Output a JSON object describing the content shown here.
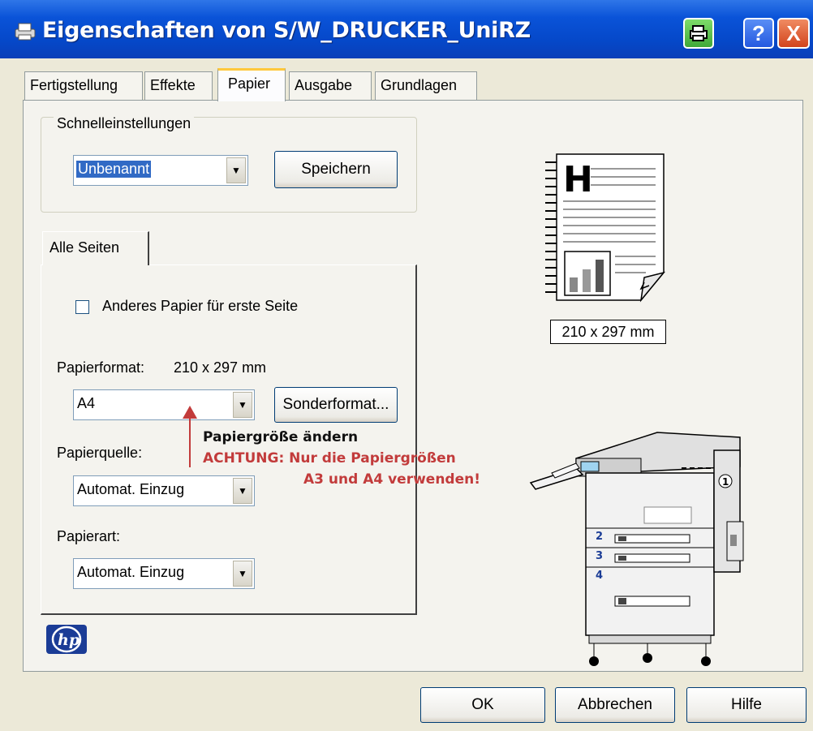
{
  "window": {
    "title": "Eigenschaften von S/W_DRUCKER_UniRZ"
  },
  "titlebar_buttons": {
    "help": "?",
    "close": "X"
  },
  "tabs": [
    "Fertigstellung",
    "Effekte",
    "Papier",
    "Ausgabe",
    "Grundlagen"
  ],
  "active_tab": "Papier",
  "quick_settings": {
    "legend": "Schnelleinstellungen",
    "selected": "Unbenannt",
    "save_label": "Speichern"
  },
  "inner_tab": "Alle Seiten",
  "first_page": {
    "label": "Anderes Papier für erste Seite",
    "checked": false
  },
  "paper_format": {
    "label": "Papierformat:",
    "value_text": "210 x 297 mm",
    "selected": "A4",
    "custom_label": "Sonderformat..."
  },
  "paper_source": {
    "label": "Papierquelle:",
    "selected": "Automat. Einzug"
  },
  "paper_type": {
    "label": "Papierart:",
    "selected": "Automat. Einzug"
  },
  "annotation": {
    "title": "Papiergröße ändern",
    "warning_line1": "ACHTUNG:  Nur die Papiergrößen",
    "warning_line2": "A3 und A4 verwenden!",
    "color": "#c23b3b"
  },
  "preview": {
    "size_text": "210 x 297 mm",
    "page_letter": "H"
  },
  "printer_trays": [
    "1",
    "2",
    "3",
    "4"
  ],
  "footer": {
    "ok": "OK",
    "cancel": "Abbrechen",
    "help": "Hilfe"
  },
  "brand": {
    "logo_text": "hp",
    "color": "#1b3c96"
  }
}
